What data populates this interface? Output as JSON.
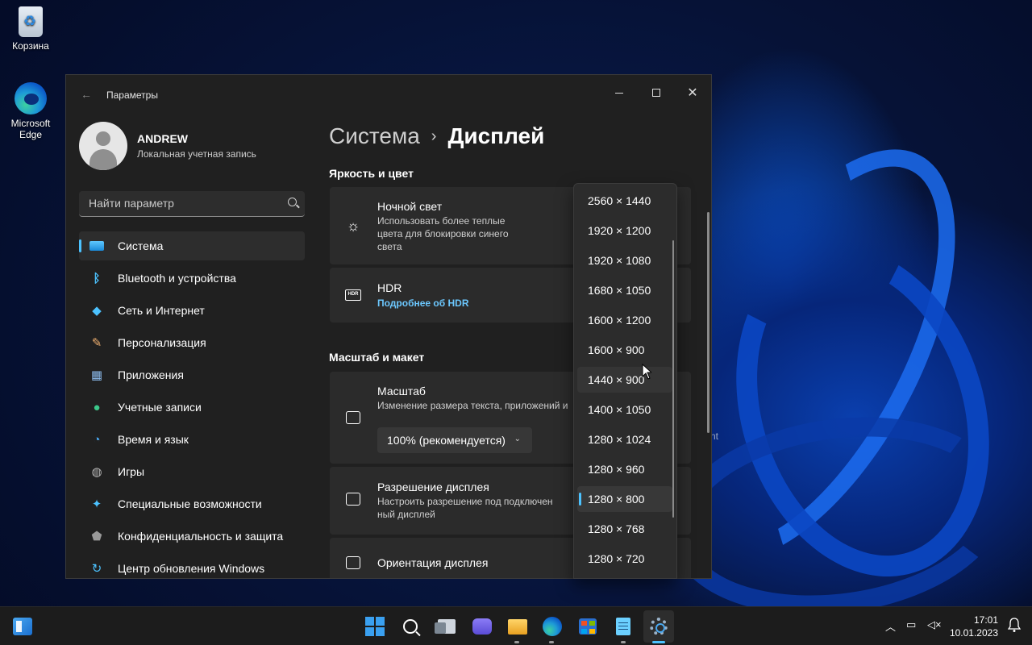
{
  "desktop": {
    "recycle_bin_label": "Корзина",
    "edge_label": "Microsoft Edge"
  },
  "window": {
    "title": "Параметры"
  },
  "profile": {
    "name": "ANDREW",
    "account_type": "Локальная учетная запись"
  },
  "search": {
    "placeholder": "Найти параметр"
  },
  "sidebar": {
    "items": [
      {
        "label": "Система",
        "icon": "monitor-icon",
        "active": true
      },
      {
        "label": "Bluetooth и устройства",
        "icon": "bluetooth-icon"
      },
      {
        "label": "Сеть и Интернет",
        "icon": "wifi-icon"
      },
      {
        "label": "Персонализация",
        "icon": "brush-icon"
      },
      {
        "label": "Приложения",
        "icon": "apps-icon"
      },
      {
        "label": "Учетные записи",
        "icon": "account-icon"
      },
      {
        "label": "Время и язык",
        "icon": "globe-clock-icon"
      },
      {
        "label": "Игры",
        "icon": "gamepad-icon"
      },
      {
        "label": "Специальные возможности",
        "icon": "accessibility-icon"
      },
      {
        "label": "Конфиденциальность и защита",
        "icon": "shield-icon"
      },
      {
        "label": "Центр обновления Windows",
        "icon": "update-icon"
      }
    ]
  },
  "main": {
    "breadcrumb_parent": "Система",
    "breadcrumb_separator": "›",
    "breadcrumb_current": "Дисплей",
    "section_brightness": "Яркость и цвет",
    "night_light_title": "Ночной свет",
    "night_light_desc_1": "Использовать более теплые",
    "night_light_desc_2": "цвета для блокировки синего",
    "night_light_desc_3": "света",
    "hdr_title": "HDR",
    "hdr_link": "Подробнее об HDR",
    "hdr_badge": "HDR",
    "section_scale": "Масштаб и макет",
    "scale_title": "Масштаб",
    "scale_desc": "Изменение размера текста, приложений и",
    "scale_value": "100% (рекомендуется)",
    "resolution_title": "Разрешение дисплея",
    "resolution_desc_1": "Настроить разрешение под подключен",
    "resolution_desc_2": "ный дисплей",
    "orientation_title": "Ориентация дисплея"
  },
  "resolution_dropdown": {
    "options": [
      "2560 × 1440",
      "1920 × 1200",
      "1920 × 1080",
      "1680 × 1050",
      "1600 × 1200",
      "1600 × 900",
      "1440 × 900",
      "1400 × 1050",
      "1280 × 1024",
      "1280 × 960",
      "1280 × 800",
      "1280 × 768",
      "1280 × 720"
    ],
    "selected": "1280 × 800",
    "hovered": "1440 × 900"
  },
  "background_fragment": "nt",
  "taskbar": {
    "time": "17:01",
    "date": "10.01.2023",
    "apps": [
      "start-icon",
      "search-icon",
      "task-view-icon",
      "chat-icon",
      "file-explorer-icon",
      "edge-icon",
      "store-icon",
      "notepad-icon",
      "settings-icon"
    ]
  },
  "colors": {
    "accent": "#4cc2ff",
    "window_bg": "#202020",
    "card_bg": "#2b2b2b"
  }
}
